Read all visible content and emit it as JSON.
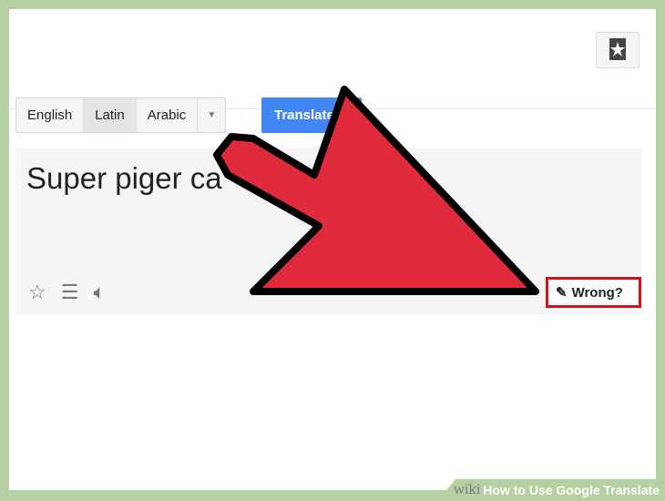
{
  "languages": {
    "items": [
      "English",
      "Latin",
      "Arabic"
    ],
    "selected": "Latin"
  },
  "translate_label": "Translate",
  "result_text": "Super piger ca",
  "wrong_label": "Wrong?",
  "banner": {
    "wiki": "wiki",
    "title": "How to Use Google Translate"
  },
  "colors": {
    "accent": "#4285f4",
    "arrow": "#e02b3c",
    "highlight": "#d3101e",
    "frame": "#b7d0a1"
  }
}
